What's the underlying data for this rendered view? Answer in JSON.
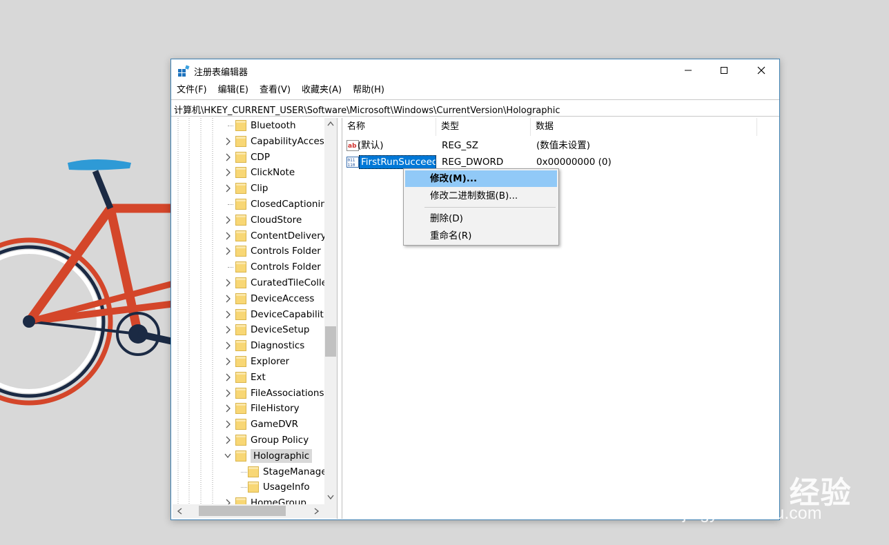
{
  "window": {
    "title": "注册表编辑器"
  },
  "menubar": {
    "items": [
      "文件(F)",
      "编辑(E)",
      "查看(V)",
      "收藏夹(A)",
      "帮助(H)"
    ]
  },
  "address": "计算机\\HKEY_CURRENT_USER\\Software\\Microsoft\\Windows\\CurrentVersion\\Holographic",
  "tree": {
    "items": [
      {
        "label": "Bluetooth",
        "expandable": false
      },
      {
        "label": "CapabilityAccess",
        "expandable": true
      },
      {
        "label": "CDP",
        "expandable": true
      },
      {
        "label": "ClickNote",
        "expandable": true
      },
      {
        "label": "Clip",
        "expandable": true
      },
      {
        "label": "ClosedCaptioning",
        "expandable": false
      },
      {
        "label": "CloudStore",
        "expandable": true
      },
      {
        "label": "ContentDeliveryManager",
        "expandable": true
      },
      {
        "label": "Controls Folder",
        "expandable": true
      },
      {
        "label": "Controls Folder",
        "expandable": false
      },
      {
        "label": "CuratedTileCollections",
        "expandable": true
      },
      {
        "label": "DeviceAccess",
        "expandable": true
      },
      {
        "label": "DeviceCapabilities",
        "expandable": true
      },
      {
        "label": "DeviceSetup",
        "expandable": true
      },
      {
        "label": "Diagnostics",
        "expandable": true
      },
      {
        "label": "Explorer",
        "expandable": true
      },
      {
        "label": "Ext",
        "expandable": true
      },
      {
        "label": "FileAssociations",
        "expandable": true
      },
      {
        "label": "FileHistory",
        "expandable": true
      },
      {
        "label": "GameDVR",
        "expandable": true
      },
      {
        "label": "Group Policy",
        "expandable": true
      },
      {
        "label": "Holographic",
        "expandable": true,
        "expanded": true,
        "selected": true
      },
      {
        "label": "StageManagement",
        "child": true
      },
      {
        "label": "UsageInfo",
        "child": true
      },
      {
        "label": "HomeGroup",
        "expandable": true
      }
    ]
  },
  "list": {
    "columns": [
      "名称",
      "类型",
      "数据"
    ],
    "rows": [
      {
        "name": "(默认)",
        "type": "REG_SZ",
        "data": "(数值未设置)",
        "icon": "string-value-icon"
      },
      {
        "name": "FirstRunSucceeded",
        "type": "REG_DWORD",
        "data": "0x00000000 (0)",
        "icon": "dword-value-icon",
        "selected": true
      }
    ]
  },
  "context_menu": {
    "modify": "修改(M)...",
    "modify_binary": "修改二进制数据(B)...",
    "delete": "删除(D)",
    "rename": "重命名(R)"
  },
  "watermark": {
    "main": "Bai du 经验",
    "sub": "jingyan.baidu.com"
  },
  "colors": {
    "selection": "#0078d7",
    "menu_highlight": "#91c9f7",
    "folder": "#f8d775",
    "window_border": "#3c7fb1"
  }
}
